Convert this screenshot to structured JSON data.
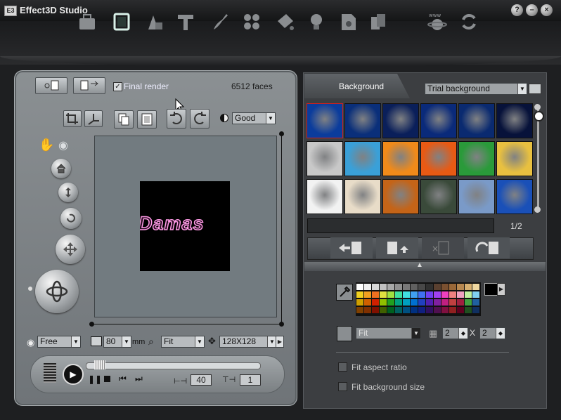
{
  "app": {
    "title": "Effect3D Studio",
    "window_buttons": [
      "?",
      "–",
      "×"
    ]
  },
  "toolbar": {
    "icons": [
      "briefcase-icon",
      "frame-icon",
      "shapes-icon",
      "text-t-icon",
      "brush-icon",
      "dots-icon",
      "paint-bucket-icon",
      "bulb-icon",
      "gear-doc-icon",
      "export-icon",
      "www-globe-icon",
      "refresh-icon"
    ]
  },
  "render": {
    "final_render_label": "Final render",
    "final_render_checked": true,
    "faces": "6512 faces",
    "quality": "Good"
  },
  "preview": {
    "text": "Damas"
  },
  "bottom_controls": {
    "projection": "Free",
    "depth_value": "80",
    "depth_unit": "mm",
    "zoom": "Fit",
    "resolution": "128X128"
  },
  "playback": {
    "frame_count": "40",
    "step": "1"
  },
  "background_panel": {
    "tab_label": "Background",
    "source_select": "Trial background",
    "page": "1/2",
    "name_field": "",
    "thumbnail_colors": [
      [
        "#0b3c9c",
        "#0a2f7a",
        "#0a1f5a",
        "#0a2a7a",
        "#0a2a70",
        "#07123a"
      ],
      [
        "#c8c8c8",
        "#3aa0d8",
        "#f08a1a",
        "#e85a14",
        "#2a9a3a",
        "#e8c040"
      ],
      [
        "#f2f2f2",
        "#e8dcc8",
        "#c46418",
        "#3a4a3a",
        "#7a9ac8",
        "#1a50b8"
      ]
    ]
  },
  "color_panel": {
    "selected_color": "#000000"
  },
  "tile_settings": {
    "mode": "Fit",
    "tiles_x": "2",
    "x_label": "X",
    "tiles_y": "2"
  },
  "options": {
    "fit_aspect_ratio": "Fit aspect ratio",
    "fit_background_size": "Fit background size"
  }
}
